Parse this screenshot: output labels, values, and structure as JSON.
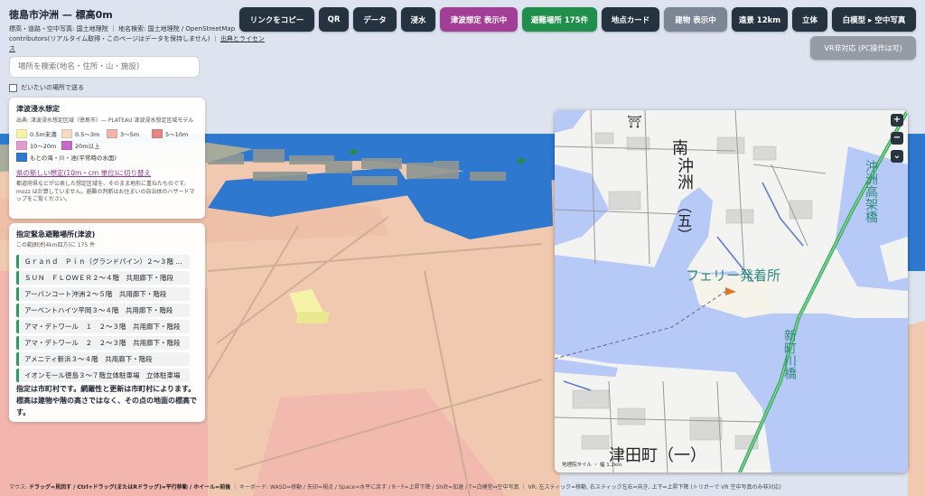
{
  "title": "徳島市沖洲 — 標高0m",
  "attribution": {
    "line1": "標高・道路・空中写真: 国土地理院 ｜ 地名検索: 国土地理院 / OpenStreetMap contributors(リアルタイム取得・このページはデータを保持しません) ｜",
    "link": "出典とライセンス"
  },
  "toolbar": {
    "copy_link": "リンクをコピー",
    "qr": "QR",
    "data": "データ",
    "flood": "浸水",
    "tsunami": "津波想定 表示中",
    "shelters": "避難場所 175件",
    "point_card": "地点カード",
    "buildings": "建物 表示中",
    "view_distance": "遠景 12km",
    "solid": "立体",
    "white_model": "白模型 ▸ 空中写真",
    "vr": "VR非対応 (PC操作は可)"
  },
  "search": {
    "placeholder": "場所を検索(地名・住所・山・施設)"
  },
  "checkbox": {
    "label": "だいたいの場所で送る"
  },
  "tsunami_panel": {
    "title": "津波浸水想定",
    "source": "出典: 津波浸水想定区域（徳島市）— PLATEAU 津波浸水想定区域モデル",
    "legend": [
      {
        "label": "0.5m未満",
        "color": "#f5f3a8"
      },
      {
        "label": "0.5〜3m",
        "color": "#f8d9c4"
      },
      {
        "label": "3〜5m",
        "color": "#f2b3ae"
      },
      {
        "label": "5〜10m",
        "color": "#e88482"
      },
      {
        "label": "10〜20m",
        "color": "#e39ccf"
      },
      {
        "label": "20m以上",
        "color": "#c36bc5"
      },
      {
        "label": "もとの海・川・池(平常時の水面)",
        "color": "#2f78d0"
      }
    ],
    "switch_link": "県の新しい想定(10m・cm 単位)に切り替え",
    "note": "都道府県などが公表した想定区域を、そのまま地形に重ねたものです。mozz は計算していません。避難の判断はお住まいの自治体のハザードマップをご覧ください。"
  },
  "shelter_panel": {
    "title": "指定緊急避難場所(津波)",
    "count": "この範囲(約4km四方)に 175 件",
    "items": [
      "Ｇｒａｎｄ　Ｐｉｎ（グランドパイン）２〜３階 ...",
      "ＳＵＮ　ＦＬＯＷＥＲ２〜４階　共用廊下・階段",
      "アーバンコート沖洲２〜５階　共用廊下・階段",
      "アーベントハイツ平岡３〜４階　共用廊下・階段",
      "アマ・デトワール　１　２〜３階　共用廊下・階段",
      "アマ・デトワール　２　２〜３階　共用廊下・階段",
      "アメニティ新浜３〜４階　共用廊下・階段",
      "イオンモール徳島３〜７階立体駐車場　立体駐車場"
    ],
    "footer": "指定は市町村です。網羅性と更新は市町村によります。標高は建物や階の高さではなく、その点の地面の標高です。"
  },
  "minimap": {
    "labels": {
      "minami": "南",
      "okisu": "沖洲",
      "go": "（五）",
      "ferry": "フェリー発着所",
      "okisu_viaduct": "沖洲高架橋",
      "shinmachi_bridge": "新町川橋",
      "tsuda": "津田町（一）"
    },
    "credit": "地理院タイル ・ 幅 1.2km",
    "zoom_in": "+",
    "zoom_out": "−",
    "collapse": "⌄"
  },
  "footer": {
    "mouse_label": "マウス:",
    "mouse": "ドラッグ=見回す / Ctrl+ドラッグ(またはRドラッグ)=平行移動 / ホイール=前後",
    "keyboard": "｜ キーボード: WASD=移動 / 矢印=視点 / Space=水平に戻す / R・F=上昇下降 / Shift=加速 / T=白模型⇔空中写真 ｜ VR: 左スティック=移動, 右スティック左右=向き, 上下=上昇下降 (トリガーで VR 空中写真のみ非対応)"
  }
}
